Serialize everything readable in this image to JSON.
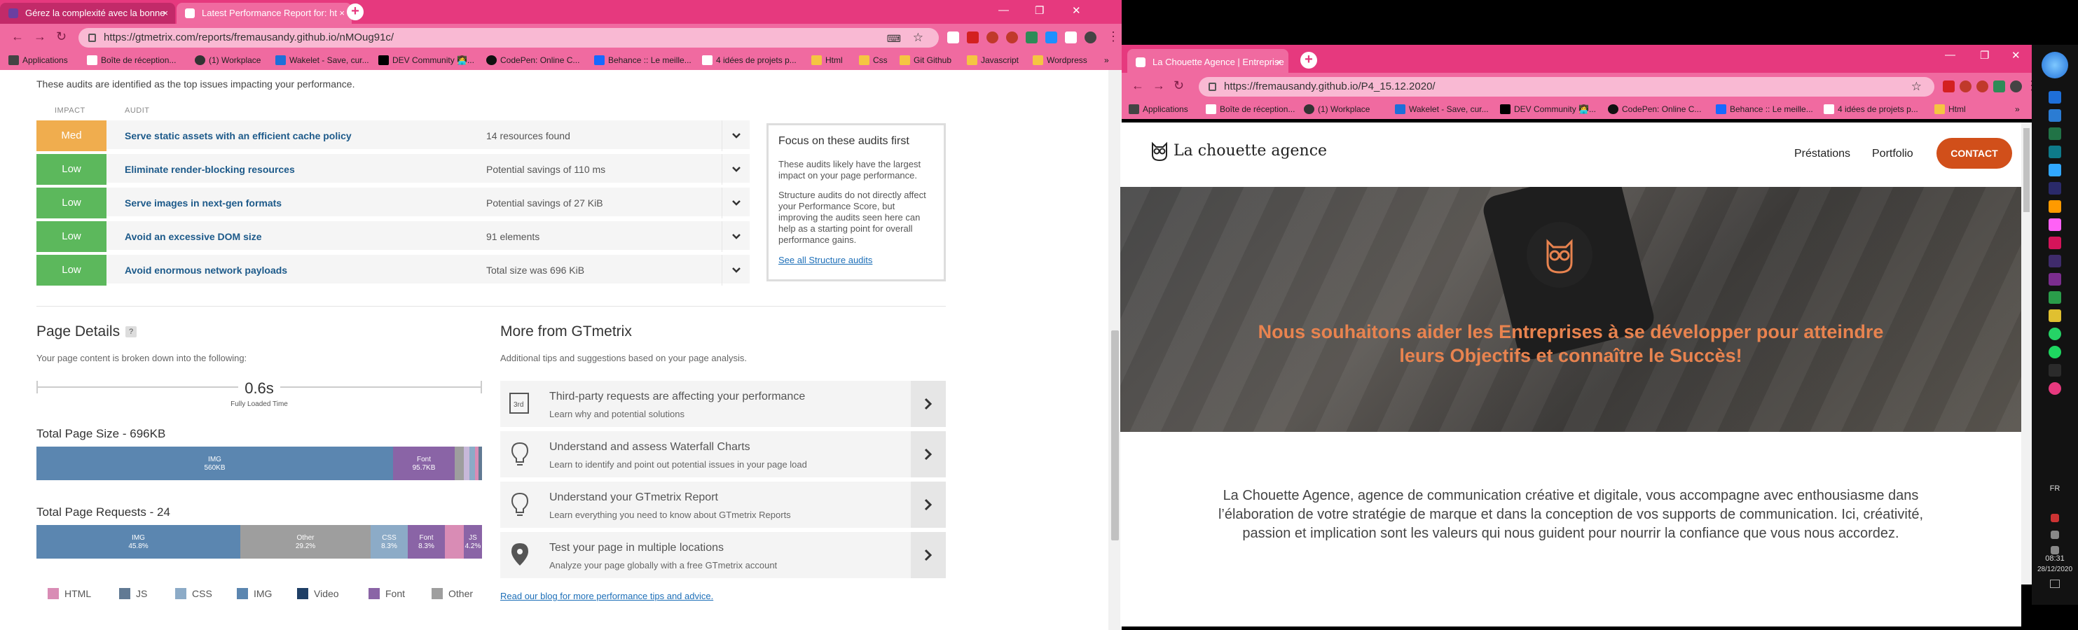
{
  "left_browser": {
    "tabs": [
      {
        "label": "Gérez la complexité avec la bonne",
        "close": "×"
      },
      {
        "label": "Latest Performance Report for: ht",
        "close": "×"
      }
    ],
    "new_tab": "+",
    "url": "https://gtmetrix.com/reports/fremausandy.github.io/nMOug91c/",
    "bookmarks": [
      "Applications",
      "Boîte de réception...",
      "(1) Workplace",
      "Wakelet - Save, cur...",
      "DEV Community 👩‍💻...",
      "CodePen: Online C...",
      "Behance :: Le meille...",
      "4 idées de projets p...",
      "Html",
      "Css",
      "Git Github",
      "Javascript",
      "Wordpress"
    ],
    "bookmarks_more": "»",
    "window_controls": [
      "—",
      "❐",
      "✕"
    ]
  },
  "gtmetrix": {
    "intro": "These audits are identified as the top issues impacting your performance.",
    "headers": {
      "impact": "IMPACT",
      "audit": "AUDIT"
    },
    "audits": [
      {
        "impact": "Med",
        "color": "#f0ad4e",
        "title": "Serve static assets with an efficient cache policy",
        "value": "14 resources found"
      },
      {
        "impact": "Low",
        "color": "#5cb85c",
        "title": "Eliminate render-blocking resources",
        "value": "Potential savings of 110 ms"
      },
      {
        "impact": "Low",
        "color": "#5cb85c",
        "title": "Serve images in next-gen formats",
        "value": "Potential savings of 27 KiB"
      },
      {
        "impact": "Low",
        "color": "#5cb85c",
        "title": "Avoid an excessive DOM size",
        "value": "91 elements"
      },
      {
        "impact": "Low",
        "color": "#5cb85c",
        "title": "Avoid enormous network payloads",
        "value": "Total size was 696 KiB"
      }
    ],
    "focus": {
      "title": "Focus on these audits first",
      "p1": "These audits likely have the largest impact on your page performance.",
      "p2": "Structure audits do not directly affect your Performance Score, but improving the audits seen here can help as a starting point for overall performance gains.",
      "link": "See all Structure audits"
    },
    "page_details": {
      "title": "Page Details",
      "help": "?",
      "subtitle": "Your page content is broken down into the following:",
      "fully_loaded_value": "0.6s",
      "fully_loaded_label": "Fully Loaded Time",
      "size_title": "Total Page Size - 696KB",
      "size_segments": [
        {
          "label": "IMG",
          "value": "560KB",
          "fraction": 0.8,
          "color": "#5b86b0"
        },
        {
          "label": "Font",
          "value": "95.7KB",
          "fraction": 0.138,
          "color": "#8a64a6"
        },
        {
          "label": "",
          "value": "",
          "fraction": 0.02,
          "color": "#9e9e9e"
        },
        {
          "label": "",
          "value": "",
          "fraction": 0.012,
          "color": "#c7b8d9"
        },
        {
          "label": "",
          "value": "",
          "fraction": 0.012,
          "color": "#8cabc7"
        },
        {
          "label": "",
          "value": "",
          "fraction": 0.008,
          "color": "#d98cb5"
        },
        {
          "label": "",
          "value": "",
          "fraction": 0.01,
          "color": "#617a94"
        }
      ],
      "requests_title": "Total Page Requests - 24",
      "request_segments": [
        {
          "label": "IMG",
          "value": "45.8%",
          "fraction": 0.458,
          "color": "#5b86b0"
        },
        {
          "label": "Other",
          "value": "29.2%",
          "fraction": 0.292,
          "color": "#9e9e9e"
        },
        {
          "label": "CSS",
          "value": "8.3%",
          "fraction": 0.083,
          "color": "#8cabc7"
        },
        {
          "label": "Font",
          "value": "8.3%",
          "fraction": 0.083,
          "color": "#8a64a6"
        },
        {
          "label": "",
          "value": "",
          "fraction": 0.042,
          "color": "#d98cb5"
        },
        {
          "label": "JS",
          "value": "4.2%",
          "fraction": 0.042,
          "color": "#8a64a6"
        }
      ],
      "legend": [
        {
          "label": "HTML",
          "color": "#d98cb5"
        },
        {
          "label": "JS",
          "color": "#617a94"
        },
        {
          "label": "CSS",
          "color": "#8cabc7"
        },
        {
          "label": "IMG",
          "color": "#5b86b0"
        },
        {
          "label": "Video",
          "color": "#1f3f66"
        },
        {
          "label": "Font",
          "color": "#8a64a6"
        },
        {
          "label": "Other",
          "color": "#9e9e9e"
        }
      ]
    },
    "more": {
      "title": "More from GTmetrix",
      "subtitle": "Additional tips and suggestions based on your page analysis.",
      "items": [
        {
          "icon": "3rd-party-icon",
          "title": "Third-party requests are affecting your performance",
          "sub": "Learn why and potential solutions"
        },
        {
          "icon": "lightbulb-icon",
          "title": "Understand and assess Waterfall Charts",
          "sub": "Learn to identify and point out potential issues in your page load"
        },
        {
          "icon": "lightbulb-icon",
          "title": "Understand your GTmetrix Report",
          "sub": "Learn everything you need to know about GTmetrix Reports"
        },
        {
          "icon": "map-pin-icon",
          "title": "Test your page in multiple locations",
          "sub": "Analyze your page globally with a free GTmetrix account"
        }
      ],
      "blog_link": "Read our blog for more performance tips and advice."
    }
  },
  "right_browser": {
    "tab": {
      "label": "La Chouette Agence | Entreprise",
      "close": "×"
    },
    "new_tab": "+",
    "url": "https://fremausandy.github.io/P4_15.12.2020/",
    "bookmarks": [
      "Applications",
      "Boîte de réception...",
      "(1) Workplace",
      "Wakelet - Save, cur...",
      "DEV Community 👩‍💻...",
      "CodePen: Online C...",
      "Behance :: Le meille...",
      "4 idées de projets p...",
      "Html"
    ],
    "bookmarks_more": "»",
    "window_controls": [
      "—",
      "❐",
      "✕"
    ]
  },
  "site": {
    "logo_text": "La chouette agence",
    "nav": [
      "Préstations",
      "Portfolio"
    ],
    "contact": "CONTACT",
    "accent": "#d14f1a",
    "hero_text": "Nous souhaitons aider les Entreprises à se développer pour atteindre leurs Objectifs et connaître le Succès!",
    "hero_color": "#e8834f",
    "intro": "La Chouette Agence, agence de communication créative et digitale, vous accompagne avec enthousiasme dans l’élaboration de votre stratégie de marque et dans la conception de vos supports de communication. Ici, créativité, passion et implication sont les valeurs qui nous guident pour nourrir la confiance que vous nous accordez."
  },
  "taskbar": {
    "lang": "FR",
    "time": "08:31",
    "date": "28/12/2020"
  }
}
